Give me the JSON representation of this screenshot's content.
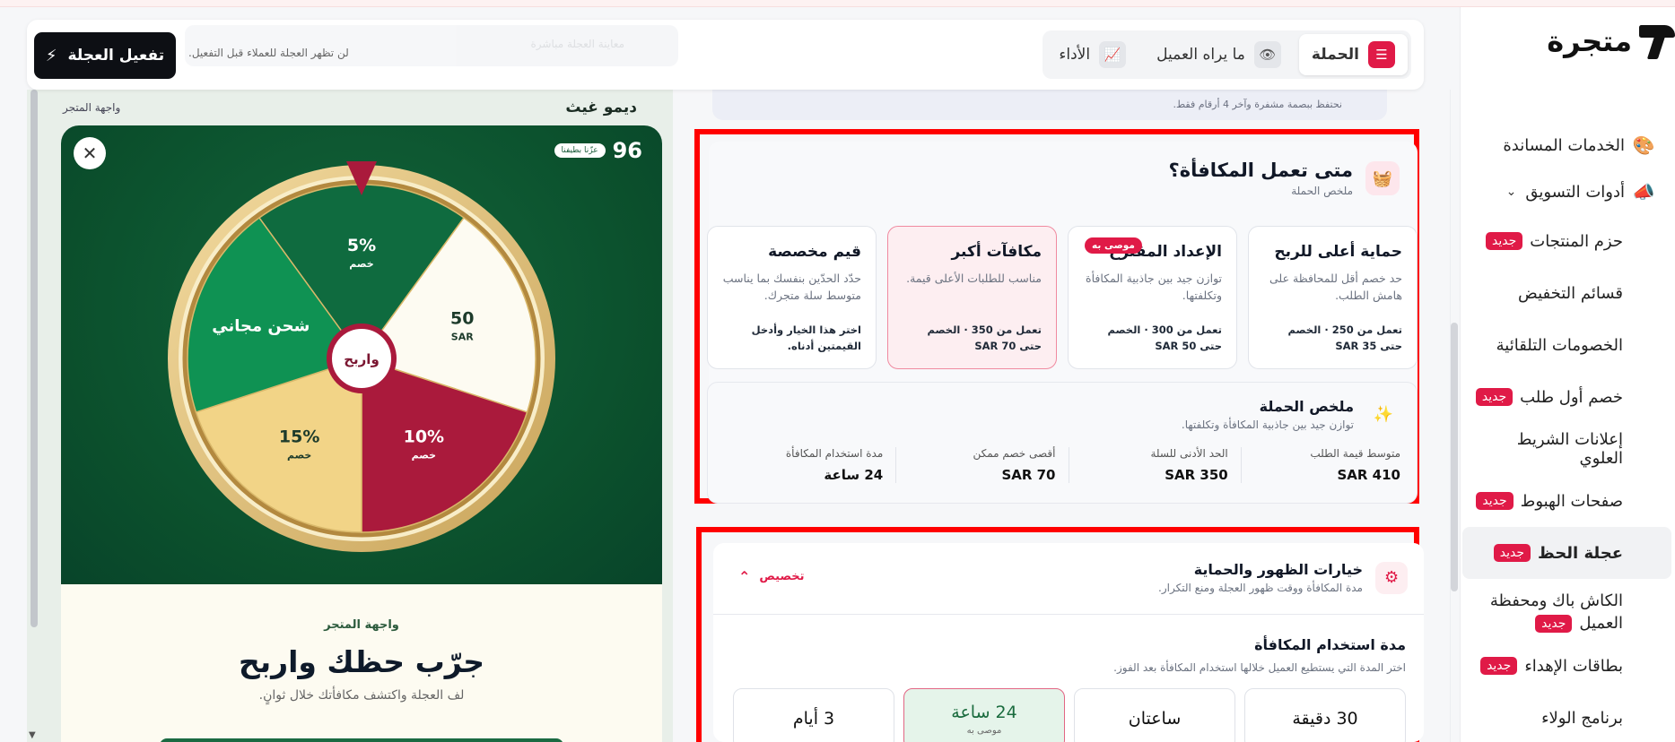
{
  "brand": {
    "name": "متجرة"
  },
  "sidebar": {
    "items": [
      {
        "label": "الخدمات المساندة",
        "icon": "palette-icon",
        "type": "top"
      },
      {
        "label": "أدوات التسويق",
        "icon": "megaphone-icon",
        "type": "top-expanded"
      },
      {
        "label": "حزم المنتجات",
        "badge": "جديد"
      },
      {
        "label": "قسائم التخفيض",
        "badge": ""
      },
      {
        "label": "الخصومات التلقائية",
        "badge": ""
      },
      {
        "label": "خصم أول طلب",
        "badge": "جديد"
      },
      {
        "label": "إعلانات الشريط العلوي",
        "badge": ""
      },
      {
        "label": "صفحات الهبوط",
        "badge": "جديد"
      },
      {
        "label": "عجلة الحظ",
        "badge": "جديد",
        "active": true
      },
      {
        "label_l1": "الكاش باك ومحفظة",
        "label_l2": "العميل",
        "badge": "جديد"
      },
      {
        "label": "بطاقات الإهداء",
        "badge": "جديد"
      },
      {
        "label": "برنامج الولاء",
        "badge": ""
      }
    ]
  },
  "topbar": {
    "tabs": [
      {
        "label": "الحملة",
        "icon": "sliders-icon",
        "active": true
      },
      {
        "label": "ما يراه العميل",
        "icon": "eye-icon",
        "active": false
      },
      {
        "label": "الأداء",
        "icon": "chart-line-icon",
        "active": false
      }
    ],
    "activate_label": "تفعيل العجلة",
    "activate_note": "لن تظهر العجلة للعملاء قبل التفعيل.",
    "ghost_text": "معاينة العجلة مباشرة"
  },
  "preview": {
    "store_name": "ديمو غيث",
    "storefront_label": "واجهة المتجر",
    "score": "96",
    "score_pill": "عزّنا بطيفنا",
    "segments": [
      {
        "label": "5%",
        "sub": "خصم",
        "color": "#0f6b3f"
      },
      {
        "label": "50",
        "sub": "SAR",
        "color": "#fdfbf2"
      },
      {
        "label": "10%",
        "sub": "خصم",
        "color": "#aa1a3c"
      },
      {
        "label": "15%",
        "sub": "خصم",
        "color": "#f2d487"
      },
      {
        "label": "شحن مجاني",
        "sub": "",
        "color": "#0f9253"
      }
    ],
    "center_label": "واربح",
    "bottom_label": "واجهة المتجر",
    "bottom_title": "جرّب حظك واربح",
    "bottom_sub": "لف العجلة واكتشف مكافأتك خلال ثوانٍ."
  },
  "stub": {
    "text": "نحتفظ ببصمة مشفرة وآخر 4 أرقام فقط."
  },
  "reward": {
    "title": "متى تعمل المكافأة؟",
    "subtitle": "ملخص الحملة",
    "options": [
      {
        "title": "حماية أعلى للربح",
        "desc": "حد خصم أقل للمحافظة على هامش الطلب.",
        "foot": "تعمل من 250 · الخصم حتى SAR 35",
        "recommended": "",
        "selected": false
      },
      {
        "title": "الإعداد المقترح",
        "desc": "توازن جيد بين جاذبية المكافأة وتكلفتها.",
        "foot": "تعمل من 300 · الخصم حتى SAR 50",
        "recommended": "موصى به",
        "selected": false
      },
      {
        "title": "مكافآت أكبر",
        "desc": "مناسب للطلبات الأعلى قيمة.",
        "foot": "تعمل من 350 · الخصم حتى SAR 70",
        "recommended": "",
        "selected": true
      },
      {
        "title": "قيم مخصصة",
        "desc": "حدّد الحدّين بنفسك بما يناسب متوسط سلة متجرك.",
        "foot": "اختر هذا الخيار وأدخل القيمتين أدناه.",
        "recommended": "",
        "selected": false
      }
    ],
    "summary": {
      "title": "ملخص الحملة",
      "subtitle": "توازن جيد بين جاذبية المكافأة وتكلفتها.",
      "stats": [
        {
          "key": "متوسط قيمة الطلب",
          "value": "SAR 410"
        },
        {
          "key": "الحد الأدنى للسلة",
          "value": "SAR 350"
        },
        {
          "key": "أقصى خصم ممكن",
          "value": "SAR 70"
        },
        {
          "key": "مدة استخدام المكافأة",
          "value": "24 ساعة"
        }
      ]
    }
  },
  "visibility": {
    "title": "خيارات الظهور والحماية",
    "subtitle": "مدة المكافأة ووقت ظهور العجلة ومنع التكرار.",
    "customize_label": "تخصيص",
    "field_title": "مدة استخدام المكافأة",
    "field_sub": "اختر المدة التي يستطيع العميل خلالها استخدام المكافأة بعد الفوز.",
    "durations": [
      {
        "label": "30 دقيقة",
        "note": "",
        "selected": false
      },
      {
        "label": "ساعتان",
        "note": "",
        "selected": false
      },
      {
        "label": "24 ساعة",
        "note": "موصى به",
        "selected": true
      },
      {
        "label": "3 أيام",
        "note": "",
        "selected": false
      }
    ]
  }
}
